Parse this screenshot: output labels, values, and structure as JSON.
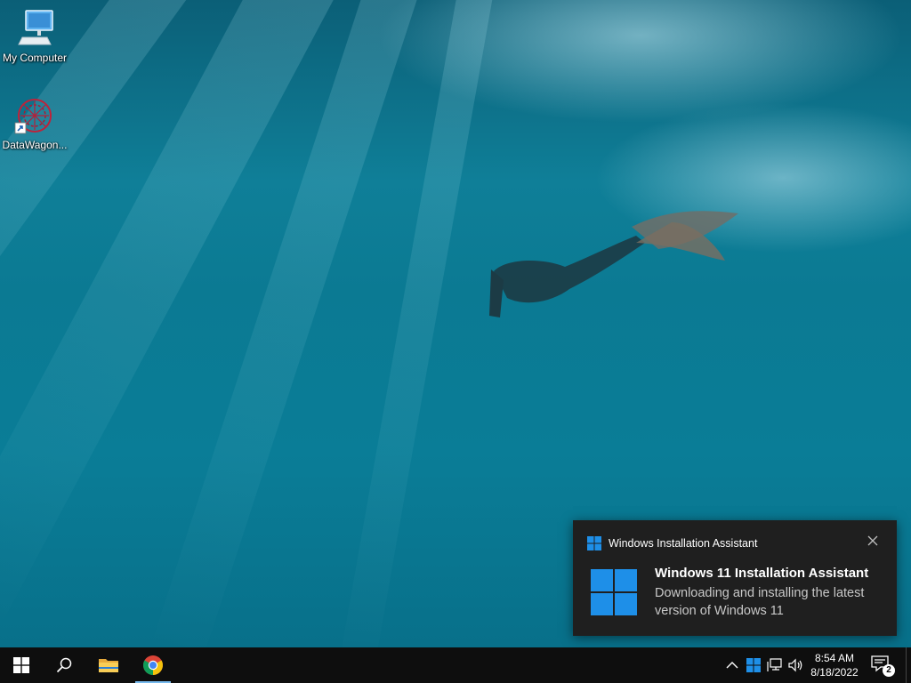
{
  "desktop": {
    "icons": [
      {
        "label": "My Computer",
        "icon": "computer-icon"
      },
      {
        "label": "DataWagon...",
        "icon": "datawagon-icon"
      }
    ]
  },
  "toast": {
    "app_name": "Windows Installation Assistant",
    "title": "Windows 11 Installation Assistant",
    "body": "Downloading and installing the latest version of Windows 11",
    "close_icon": "close-icon",
    "accent": "#1e8fe8"
  },
  "taskbar": {
    "buttons": [
      {
        "name": "start-button",
        "icon": "windows-logo-icon"
      },
      {
        "name": "search-button",
        "icon": "search-icon"
      },
      {
        "name": "file-explorer-button",
        "icon": "folder-icon"
      },
      {
        "name": "chrome-button",
        "icon": "chrome-icon",
        "active": true
      }
    ],
    "tray": {
      "icons": [
        "chevron-up-icon",
        "windows-assistant-icon",
        "network-icon",
        "volume-icon"
      ],
      "time": "8:54 AM",
      "date": "8/18/2022",
      "notification_count": "2"
    }
  }
}
